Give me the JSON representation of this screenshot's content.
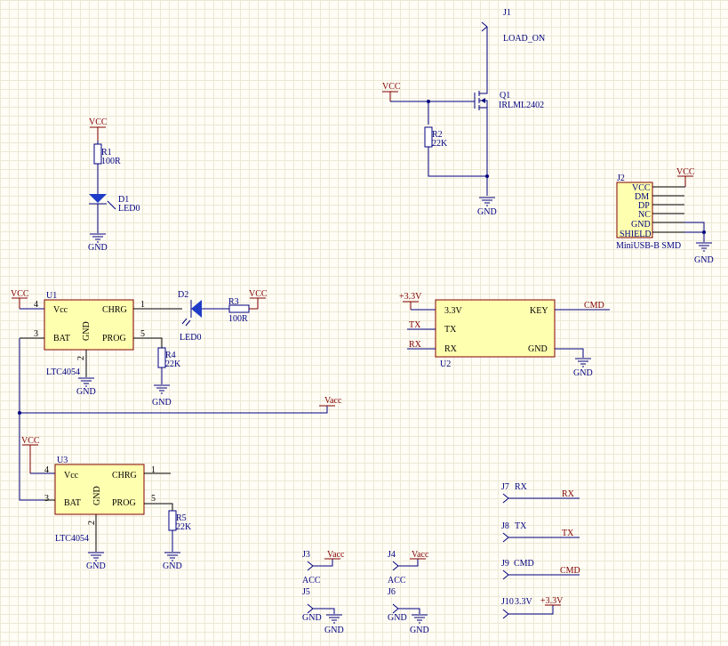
{
  "components": {
    "j1": {
      "ref": "J1",
      "name": "LOAD_ON"
    },
    "q1": {
      "ref": "Q1",
      "value": "IRLML2402"
    },
    "r1": {
      "ref": "R1",
      "value": "100R"
    },
    "r2": {
      "ref": "R2",
      "value": "22K"
    },
    "r3": {
      "ref": "R3",
      "value": "100R"
    },
    "r4": {
      "ref": "R4",
      "value": "22K"
    },
    "r5": {
      "ref": "R5",
      "value": "22K"
    },
    "d1": {
      "ref": "D1",
      "value": "LED0"
    },
    "d2": {
      "ref": "D2",
      "value": "LED0"
    },
    "u1": {
      "ref": "U1",
      "part": "LTC4054",
      "pins": {
        "vcc": "Vcc",
        "chrg": "CHRG",
        "bat": "BAT",
        "gnd": "GND",
        "prog": "PROG"
      },
      "pin_numbers": {
        "p4": "4",
        "p3": "3",
        "p2": "2",
        "p1": "1",
        "p5": "5"
      }
    },
    "u3": {
      "ref": "U3",
      "part": "LTC4054",
      "pins": {
        "vcc": "Vcc",
        "chrg": "CHRG",
        "bat": "BAT",
        "gnd": "GND",
        "prog": "PROG"
      },
      "pin_numbers": {
        "p4": "4",
        "p3": "3",
        "p2": "2",
        "p1": "1",
        "p5": "5"
      }
    },
    "u2": {
      "ref": "U2",
      "pins": {
        "v33": "3.3V",
        "tx": "TX",
        "rx": "RX",
        "key": "KEY",
        "gnd": "GND"
      }
    },
    "j2": {
      "ref": "J2",
      "value": "MiniUSB-B SMD",
      "pins": [
        "VCC",
        "DM",
        "DP",
        "NC",
        "GND",
        "SHIELD"
      ]
    },
    "j3": {
      "ref": "J3",
      "value": "ACC"
    },
    "j4": {
      "ref": "J4",
      "value": "ACC"
    },
    "j5": {
      "ref": "J5",
      "value": "GND"
    },
    "j6": {
      "ref": "J6",
      "value": "GND"
    },
    "j7": {
      "ref": "J7",
      "value": "RX"
    },
    "j8": {
      "ref": "J8",
      "value": "TX"
    },
    "j9": {
      "ref": "J9",
      "value": "CMD"
    },
    "j10": {
      "ref": "J10",
      "value": "3.3V"
    }
  },
  "nets": {
    "vcc": "VCC",
    "gnd": "GND",
    "vacc": "Vacc",
    "v33": "+3.3V",
    "tx": "TX",
    "rx": "RX",
    "cmd": "CMD"
  },
  "colors": {
    "wire": "#000080",
    "power": "#800000",
    "body": "#ffffb0",
    "grid": "#ece8d6"
  }
}
